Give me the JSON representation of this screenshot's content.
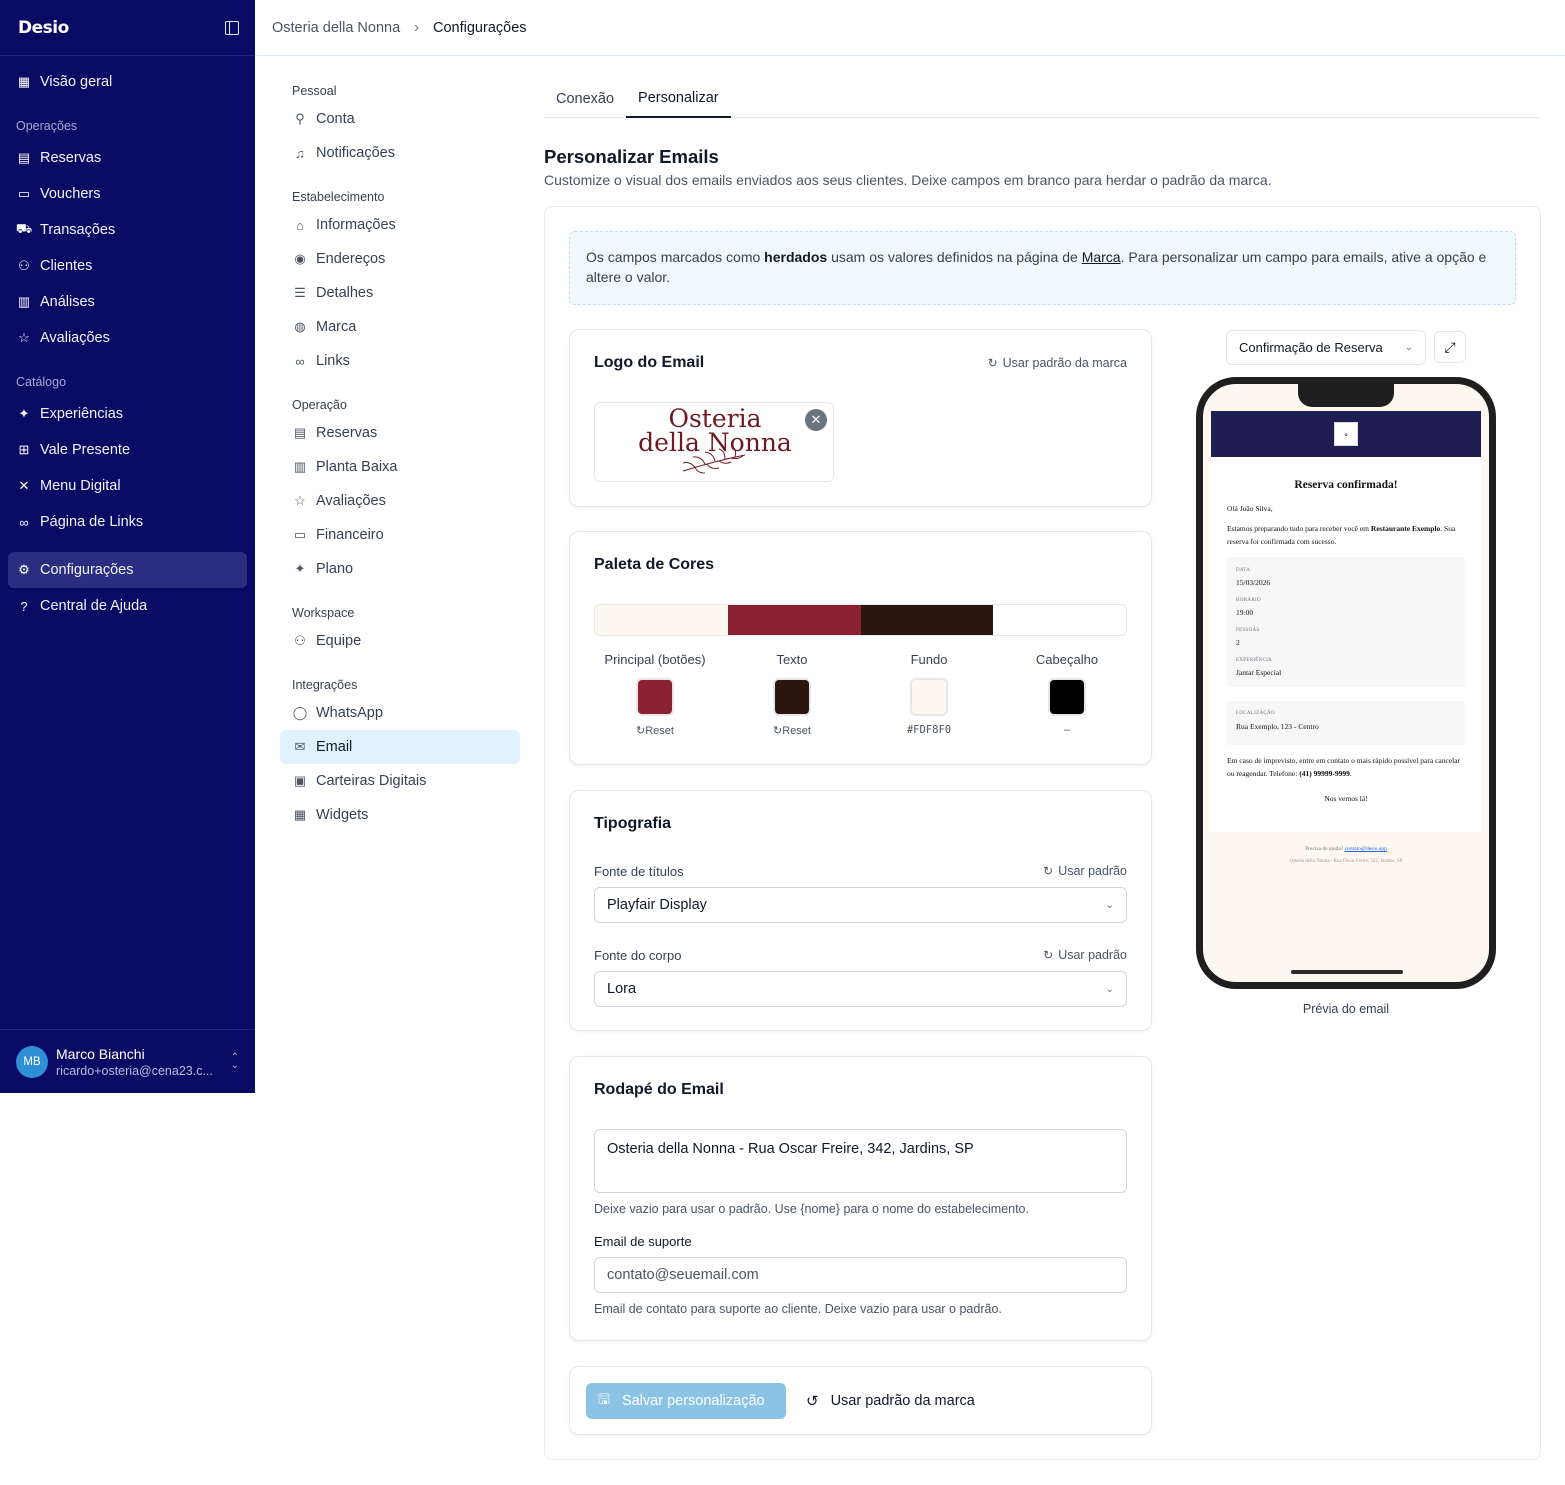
{
  "app": {
    "logo": "Desio"
  },
  "sidebar": {
    "top_items": [
      {
        "label": "Visão geral"
      }
    ],
    "sections": [
      {
        "label": "Operações"
      },
      {
        "label": "Catálogo"
      }
    ],
    "operacoes": [
      {
        "label": "Reservas"
      },
      {
        "label": "Vouchers"
      },
      {
        "label": "Transações"
      },
      {
        "label": "Clientes"
      },
      {
        "label": "Análises"
      },
      {
        "label": "Avaliações"
      }
    ],
    "catalogo": [
      {
        "label": "Experiências"
      },
      {
        "label": "Vale Presente"
      },
      {
        "label": "Menu Digital"
      },
      {
        "label": "Página de Links"
      }
    ],
    "bottom": [
      {
        "label": "Configurações"
      },
      {
        "label": "Central de Ajuda"
      }
    ],
    "user": {
      "initials": "MB",
      "name": "Marco Bianchi",
      "email": "ricardo+osteria@cena23.c..."
    }
  },
  "breadcrumb": {
    "items": [
      "Osteria della Nonna",
      "Configurações"
    ]
  },
  "settings_nav": {
    "sections": [
      "Pessoal",
      "Estabelecimento",
      "Operação",
      "Workspace",
      "Integrações"
    ],
    "pessoal": [
      "Conta",
      "Notificações"
    ],
    "estabelecimento": [
      "Informações",
      "Endereços",
      "Detalhes",
      "Marca",
      "Links"
    ],
    "operacao": [
      "Reservas",
      "Planta Baixa",
      "Avaliações",
      "Financeiro",
      "Plano"
    ],
    "workspace": [
      "Equipe"
    ],
    "integracoes": [
      "WhatsApp",
      "Email",
      "Carteiras Digitais",
      "Widgets"
    ]
  },
  "tabs": [
    {
      "label": "Conexão"
    },
    {
      "label": "Personalizar",
      "active": true
    }
  ],
  "header": {
    "title": "Personalizar Emails",
    "subtitle": "Customize o visual dos emails enviados aos seus clientes. Deixe campos em branco para herdar o padrão da marca."
  },
  "info": {
    "p1": "Os campos marcados como ",
    "bold": "herdados",
    "p2": " usam os valores definidos na página de ",
    "link": "Marca",
    "p3": ". Para personalizar um campo para emails, ative a opção e altere o valor."
  },
  "logo_card": {
    "title": "Logo do Email",
    "reset": "Usar padrão da marca",
    "logo_line1": "Osteria",
    "logo_line2": "della Nonna"
  },
  "palette_card": {
    "title": "Paleta de Cores",
    "bar_colors": [
      "#fdf8f0",
      "#8b2232",
      "#2b1710",
      "#ffffff"
    ],
    "swatches": [
      {
        "label": "Principal (botões)",
        "color": "#8b2232",
        "sub": "Reset"
      },
      {
        "label": "Texto",
        "color": "#2b1710",
        "sub": "Reset"
      },
      {
        "label": "Fundo",
        "color": "#fdf8f0",
        "sub": "#FDF8F0"
      },
      {
        "label": "Cabeçalho",
        "color": "#000000",
        "sub": "–"
      }
    ]
  },
  "typography_card": {
    "title": "Tipografia",
    "title_font_label": "Fonte de títulos",
    "title_font_value": "Playfair Display",
    "body_font_label": "Fonte do corpo",
    "body_font_value": "Lora",
    "reset": "Usar padrão"
  },
  "footer_card": {
    "title": "Rodapé do Email",
    "footer_value": "Osteria della Nonna - Rua Oscar Freire, 342, Jardins, SP",
    "footer_hint": "Deixe vazio para usar o padrão. Use {nome} para o nome do estabelecimento.",
    "support_label": "Email de suporte",
    "support_placeholder": "contato@seuemail.com",
    "support_hint": "Email de contato para suporte ao cliente. Deixe vazio para usar o padrão."
  },
  "actions": {
    "save": "Salvar personalização",
    "brand": "Usar padrão da marca"
  },
  "preview": {
    "template": "Confirmação de Reserva",
    "caption": "Prévia do email",
    "email": {
      "title": "Reserva confirmada!",
      "greeting": "Olá João Silva,",
      "intro1": "Estamos preparando tudo para receber você em ",
      "intro_bold": "Restaurante Exemplo",
      "intro2": ". Sua reserva foi confirmada com sucesso.",
      "fields": [
        {
          "k": "DATA",
          "v": "15/03/2026"
        },
        {
          "k": "HORÁRIO",
          "v": "19:00"
        },
        {
          "k": "PESSOAS",
          "v": "2"
        },
        {
          "k": "EXPERIÊNCIA",
          "v": "Jantar Especial"
        }
      ],
      "location_k": "LOCALIZAÇÃO",
      "location_v": "Rua Exemplo, 123 - Centro",
      "note1": "Em caso de imprevisto, entre em contato o mais rápido possível para cancelar ou reagendar. Telefone: ",
      "note_bold": "(41) 99999-9999",
      "note2": ".",
      "bye": "Nos vemos lá!",
      "help": "Precisa de ajuda? ",
      "help_link": "contato@desio.app",
      "footer": "Osteria della Nonna - Rua Oscar Freire, 342, Jardins, SP"
    }
  },
  "colors": {
    "sidebar_bg": "#090a63",
    "accent": "#8ac3e3",
    "primary": "#8b2232"
  }
}
